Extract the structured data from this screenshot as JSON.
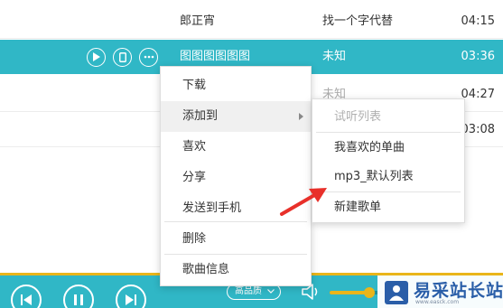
{
  "songs": [
    {
      "artist": "郎正宵",
      "album": "找一个字代替",
      "duration": "04:15"
    },
    {
      "artist": "图图图图图图",
      "album": "未知",
      "duration": "03:36"
    },
    {
      "artist": "",
      "album": "未知",
      "duration": "04:27"
    },
    {
      "artist": "",
      "album": "",
      "duration": "03:08"
    }
  ],
  "row_actions": [
    "play-icon",
    "phone-icon",
    "more-icon"
  ],
  "context_menu": {
    "items": [
      "下载",
      "添加到",
      "喜欢",
      "分享",
      "发送到手机",
      "删除",
      "歌曲信息"
    ]
  },
  "submenu": {
    "items": [
      "试听列表",
      "我喜欢的单曲",
      "mp3_默认列表",
      "新建歌单"
    ]
  },
  "player": {
    "quality_label": "高品质",
    "volume": 0.73
  },
  "watermark": {
    "name": "易采站长站",
    "url": "www.easck.com"
  },
  "colors": {
    "accent": "#30b7c6",
    "progress": "#e9b51a",
    "annotation": "#e8302a"
  }
}
